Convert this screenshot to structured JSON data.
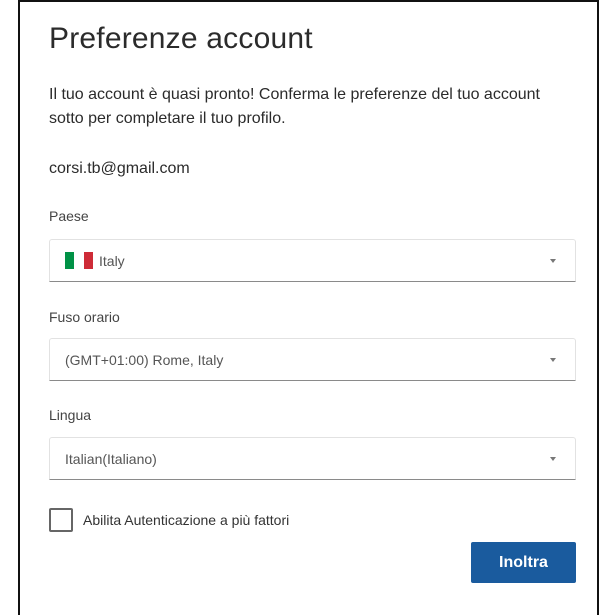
{
  "title": "Preferenze account",
  "intro": "Il tuo account è quasi pronto! Conferma le preferenze del tuo account sotto per completare il tuo profilo.",
  "email": "corsi.tb@gmail.com",
  "country": {
    "label": "Paese",
    "value": "Italy",
    "flag_icon": "italy-flag-icon"
  },
  "timezone": {
    "label": "Fuso orario",
    "value": "(GMT+01:00) Rome, Italy"
  },
  "language": {
    "label": "Lingua",
    "value": "Italian(Italiano)"
  },
  "mfa": {
    "label": "Abilita Autenticazione a più fattori",
    "checked": false
  },
  "submit_label": "Inoltra",
  "colors": {
    "primary": "#1a5b9e",
    "flag_green": "#009246",
    "flag_red": "#ce2b37"
  }
}
